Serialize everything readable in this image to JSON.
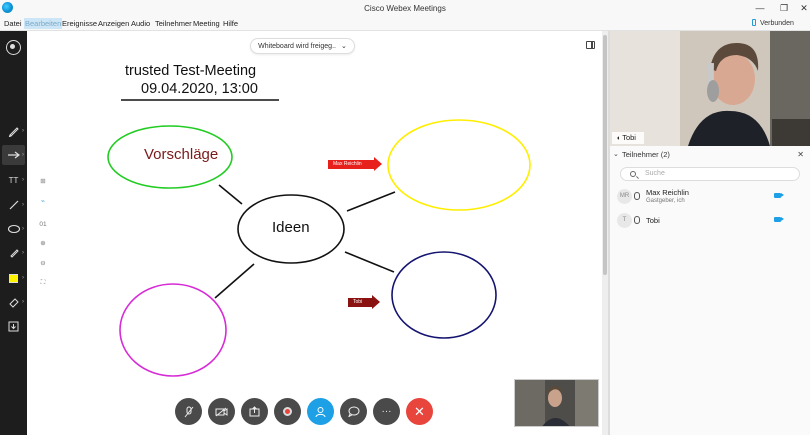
{
  "window": {
    "title": "Cisco Webex Meetings",
    "min": "—",
    "max": "❐",
    "close": "✕"
  },
  "menu": {
    "items": [
      "Datei",
      "Bearbeiten",
      "Ereignisse",
      "Anzeigen",
      "Audio",
      "Teilnehmer",
      "Meeting",
      "Hilfe"
    ],
    "active": "Bearbeiten",
    "status": "Verbunden"
  },
  "toolbar": {
    "tools": [
      "presenter-icon",
      "annotate-pen-icon",
      "arrow-pointer-icon",
      "text-icon",
      "line-icon",
      "ellipse-icon",
      "pen-icon",
      "color-swatch",
      "eraser-icon",
      "save-icon"
    ],
    "text_glyph": "TT",
    "selected_color": "#fff200"
  },
  "share": {
    "label": "Whiteboard wird freigeg..",
    "chevron": "⌄"
  },
  "zoom": {
    "page": "01"
  },
  "whiteboard": {
    "title": "trusted Test-Meeting",
    "date": "09.04.2020, 13:00",
    "topic_left": "Vorschläge",
    "center": "Ideen",
    "arrow_1": "Max Reichlin",
    "arrow_2": "Tobi",
    "colors": {
      "green": "#22cc22",
      "yellow": "#ffee00",
      "navy": "#141470",
      "magenta": "#d62bd6",
      "black": "#111111",
      "red": "#e8201c",
      "darkred": "#8a1210"
    }
  },
  "controls": {
    "buttons": [
      "mute-icon",
      "video-icon",
      "share-icon",
      "record-icon",
      "participants-icon",
      "chat-icon",
      "more-icon",
      "leave-icon"
    ],
    "more_glyph": "···",
    "leave_glyph": "✕"
  },
  "video": {
    "name": "Tobi"
  },
  "participants": {
    "header": "Teilnehmer (2)",
    "search_placeholder": "Suche",
    "people": [
      {
        "initials": "MR",
        "name": "Max Reichlin",
        "role": "Gastgeber, ich"
      },
      {
        "initials": "T",
        "name": "Tobi",
        "role": ""
      }
    ]
  }
}
